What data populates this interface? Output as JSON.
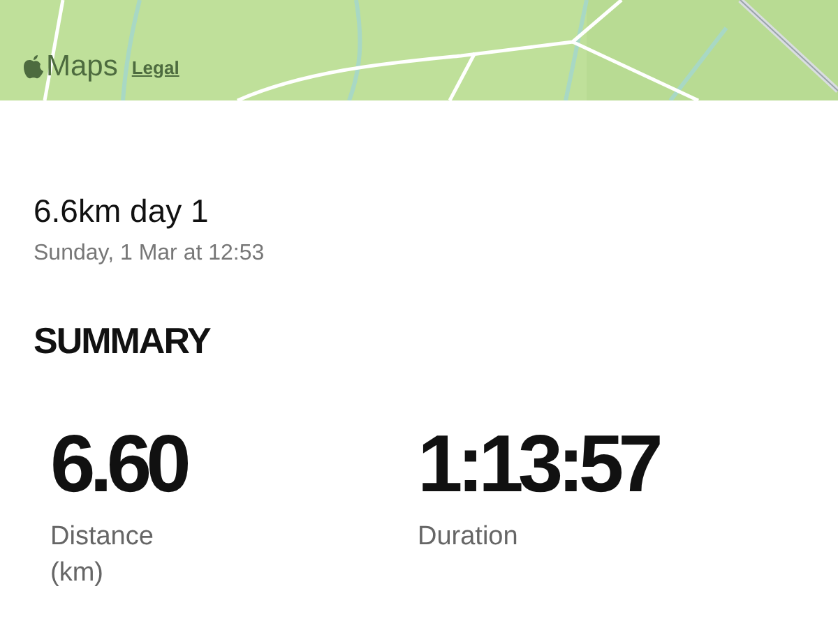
{
  "map": {
    "kind": "picture",
    "brand": "Maps",
    "legal_link": "Legal"
  },
  "workout": {
    "title": "6.6km day 1",
    "date": "Sunday, 1 Mar at 12:53"
  },
  "summary": {
    "heading": "SUMMARY",
    "stats": [
      {
        "value": "6.60",
        "label": "Distance (km)"
      },
      {
        "value": "1:13:57",
        "label": "Duration"
      }
    ]
  }
}
